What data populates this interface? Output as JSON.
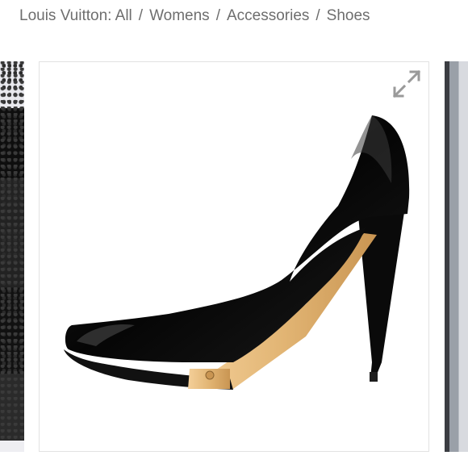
{
  "breadcrumb": {
    "items": [
      "Louis Vuitton: All",
      "Womens",
      "Accessories",
      "Shoes"
    ],
    "separator": "/"
  },
  "product_image": {
    "subject": "black peep-toe high heel pump with gold heel plate",
    "expand_icon": "expand-arrows-icon"
  },
  "colors": {
    "text_gray": "#6e6e6e",
    "shoe_black": "#0b0b0b",
    "gold_plate": "#e2b574"
  }
}
